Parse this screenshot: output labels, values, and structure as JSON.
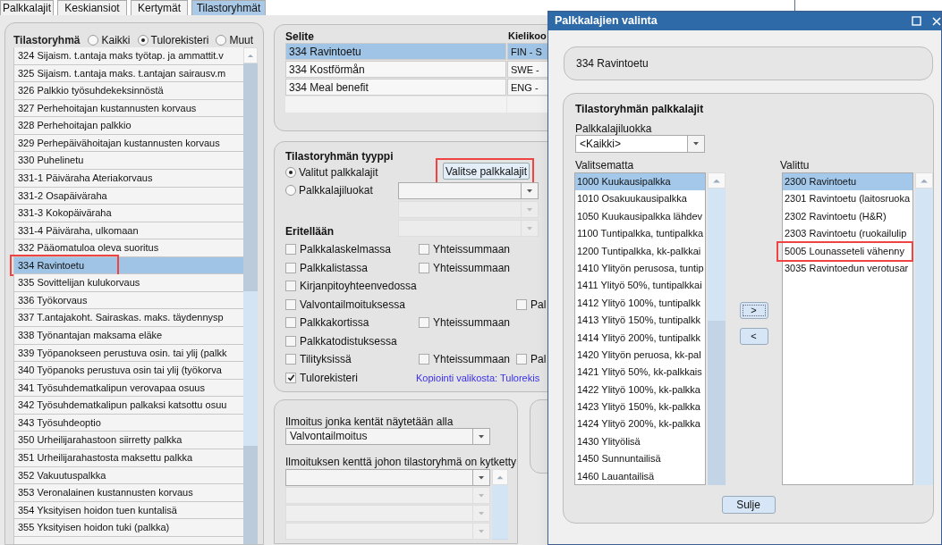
{
  "tabs": [
    {
      "label": "Palkkalajit",
      "selected": false
    },
    {
      "label": "Keskiansiot",
      "selected": false
    },
    {
      "label": "Kertymät",
      "selected": false
    },
    {
      "label": "Tilastoryhmät",
      "selected": true
    }
  ],
  "group_panel": {
    "label": "Tilastoryhmä",
    "filters": [
      {
        "label": "Kaikki",
        "selected": false
      },
      {
        "label": "Tulorekisteri",
        "selected": true
      },
      {
        "label": "Muut",
        "selected": false
      }
    ],
    "items": [
      {
        "label": "324 Sijaism. t.antaja maks työtap. ja ammattit.v",
        "selected": false,
        "highlighted": false
      },
      {
        "label": "325 Sijaism. t.antaja maks. t.antajan sairausv.m",
        "selected": false,
        "highlighted": false
      },
      {
        "label": "326 Palkkio työsuhdekeksinnöstä",
        "selected": false,
        "highlighted": false
      },
      {
        "label": "327 Perhehoitajan kustannusten korvaus",
        "selected": false,
        "highlighted": false
      },
      {
        "label": "328 Perhehoitajan palkkio",
        "selected": false,
        "highlighted": false
      },
      {
        "label": "329 Perhepäivähoitajan kustannusten korvaus",
        "selected": false,
        "highlighted": false
      },
      {
        "label": "330 Puhelinetu",
        "selected": false,
        "highlighted": false
      },
      {
        "label": "331-1 Päiväraha Ateriakorvaus",
        "selected": false,
        "highlighted": false
      },
      {
        "label": "331-2 Osapäiväraha",
        "selected": false,
        "highlighted": false
      },
      {
        "label": "331-3 Kokopäiväraha",
        "selected": false,
        "highlighted": false
      },
      {
        "label": "331-4 Päiväraha, ulkomaan",
        "selected": false,
        "highlighted": false
      },
      {
        "label": "332 Pääomatuloa oleva suoritus",
        "selected": false,
        "highlighted": false
      },
      {
        "label": "334 Ravintoetu",
        "selected": true,
        "highlighted": true
      },
      {
        "label": "335 Sovittelijan kulukorvaus",
        "selected": false,
        "highlighted": false
      },
      {
        "label": "336 Työkorvaus",
        "selected": false,
        "highlighted": false
      },
      {
        "label": "337 T.antajakoht. Sairaskas. maks. täydennysp",
        "selected": false,
        "highlighted": false
      },
      {
        "label": "338 Työnantajan maksama eläke",
        "selected": false,
        "highlighted": false
      },
      {
        "label": "339 Työpanokseen perustuva osin. tai ylij (palkk",
        "selected": false,
        "highlighted": false
      },
      {
        "label": "340 Työpanoks perustuva osin tai ylij (työkorva",
        "selected": false,
        "highlighted": false
      },
      {
        "label": "341 Työsuhdematkalipun verovapaa osuus",
        "selected": false,
        "highlighted": false
      },
      {
        "label": "342 Työsuhdematkalipun palkaksi katsottu osuu",
        "selected": false,
        "highlighted": false
      },
      {
        "label": "343 Työsuhdeoptio",
        "selected": false,
        "highlighted": false
      },
      {
        "label": "350 Urheilijarahastoon siirretty palkka",
        "selected": false,
        "highlighted": false
      },
      {
        "label": "351 Urheilijarahastosta maksettu palkka",
        "selected": false,
        "highlighted": false
      },
      {
        "label": "352 Vakuutuspalkka",
        "selected": false,
        "highlighted": false
      },
      {
        "label": "353 Veronalainen kustannusten korvaus",
        "selected": false,
        "highlighted": false
      },
      {
        "label": "354 Yksityisen hoidon tuen kuntalisä",
        "selected": false,
        "highlighted": false
      },
      {
        "label": "355 Yksityisen hoidon tuki (palkka)",
        "selected": false,
        "highlighted": false
      }
    ]
  },
  "descriptions": {
    "columns": [
      "Selite",
      "Kielikoo"
    ],
    "rows": [
      {
        "text": "334 Ravintoetu",
        "language": "FIN - S",
        "selected": true
      },
      {
        "text": "334 Kostförmån",
        "language": "SWE -",
        "selected": false
      },
      {
        "text": "334 Meal benefit",
        "language": "ENG -",
        "selected": false
      }
    ]
  },
  "type_panel": {
    "title": "Tilastoryhmän tyyppi",
    "options": [
      {
        "label": "Valitut palkkalajit",
        "selected": true
      },
      {
        "label": "Palkkalajiluokat",
        "selected": false
      }
    ],
    "button": {
      "label": "Valitse palkkalajit",
      "highlighted": true
    },
    "section": "Eritellään",
    "breakdown": [
      {
        "label": "Palkkalaskelmassa",
        "checked": false,
        "sum": {
          "label": "Yhteissummaan",
          "checked": false
        }
      },
      {
        "label": "Palkkalistassa",
        "checked": false,
        "sum": {
          "label": "Yhteissummaan",
          "checked": false
        }
      },
      {
        "label": "Kirjanpitoyhteenvedossa",
        "checked": false
      },
      {
        "label": "Valvontailmoituksessa",
        "checked": false,
        "extra": {
          "label": "Pal",
          "checked": false
        }
      },
      {
        "label": "Palkkakortissa",
        "checked": false,
        "sum": {
          "label": "Yhteissummaan",
          "checked": false
        }
      },
      {
        "label": "Palkkatodistuksessa",
        "checked": false
      },
      {
        "label": "Tilityksissä",
        "checked": false,
        "sum": {
          "label": "Yhteissummaan",
          "checked": false
        },
        "extra": {
          "label": "Pal",
          "checked": false
        }
      },
      {
        "label": "Tulorekisteri",
        "checked": true,
        "note": "Kopiointi valikosta: Tulorekis"
      }
    ]
  },
  "report_panel": {
    "report_label": "Ilmoitus jonka kentät näytetään alla",
    "report_value": "Valvontailmoitus",
    "field_label": "Ilmoituksen kenttä johon tilastoryhmä on kytketty"
  },
  "dialog": {
    "title": "Palkkalajien valinta",
    "group": "334 Ravintoetu",
    "section_title": "Tilastoryhmän palkkalajit",
    "class_label": "Palkkalajiluokka",
    "class_value": "<Kaikki>",
    "available_label": "Valitsematta",
    "available": [
      {
        "label": "1000 Kuukausipalkka",
        "selected": true
      },
      {
        "label": "1010 Osakuukausipalkka",
        "selected": false
      },
      {
        "label": "1050 Kuukausipalkka lähdev",
        "selected": false
      },
      {
        "label": "1100 Tuntipalkka, tuntipalkka",
        "selected": false
      },
      {
        "label": "1200 Tuntipalkka, kk-palkkai",
        "selected": false
      },
      {
        "label": "1410 Ylityön perusosa, tuntip",
        "selected": false
      },
      {
        "label": "1411 Ylityö 50%, tuntipalkkai",
        "selected": false
      },
      {
        "label": "1412 Ylityö 100%, tuntipalkk",
        "selected": false
      },
      {
        "label": "1413 Ylityö 150%, tuntipalkk",
        "selected": false
      },
      {
        "label": "1414 Ylityö 200%, tuntipalkk",
        "selected": false
      },
      {
        "label": "1420 Ylityön peruosa, kk-pal",
        "selected": false
      },
      {
        "label": "1421 Ylityö 50%, kk-palkkais",
        "selected": false
      },
      {
        "label": "1422 Ylityö 100%, kk-palkka",
        "selected": false
      },
      {
        "label": "1423 Ylityö 150%, kk-palkka",
        "selected": false
      },
      {
        "label": "1424 Ylityö 200%, kk-palkka",
        "selected": false
      },
      {
        "label": "1430 Ylityölisä",
        "selected": false
      },
      {
        "label": "1450 Sunnuntailisä",
        "selected": false
      },
      {
        "label": "1460 Lauantailisä",
        "selected": false
      }
    ],
    "chosen_label": "Valittu",
    "chosen": [
      {
        "label": "2300 Ravintoetu",
        "selected": true,
        "highlighted": false
      },
      {
        "label": "2301 Ravintoetu (laitosruoka",
        "selected": false,
        "highlighted": false
      },
      {
        "label": "2302 Ravintoetu (H&R)",
        "selected": false,
        "highlighted": false
      },
      {
        "label": "2303 Ravintoetu (ruokailulip",
        "selected": false,
        "highlighted": false
      },
      {
        "label": "5005 Lounasseteli vähenny",
        "selected": false,
        "highlighted": true
      },
      {
        "label": "3035 Ravintoedun verotusar",
        "selected": false,
        "highlighted": false
      }
    ],
    "add_button": ">",
    "remove_button": "<",
    "close_button": "Sulje"
  }
}
